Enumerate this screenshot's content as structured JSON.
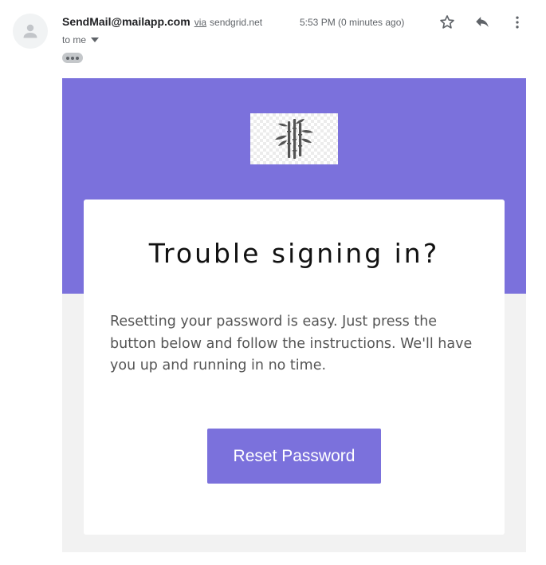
{
  "header": {
    "sender_name": "SendMail@mailapp.com",
    "via_label": "via",
    "via_domain": "sendgrid.net",
    "timestamp": "5:53 PM (0 minutes ago)",
    "to_label": "to me",
    "icons": {
      "avatar": "person-icon",
      "star": "star-icon",
      "reply": "reply-icon",
      "more": "more-vertical-icon",
      "to_dropdown": "caret-down-icon",
      "trimmed": "ellipsis-icon"
    }
  },
  "email": {
    "logo": "bamboo-logo",
    "title": "Trouble signing in?",
    "body_text": "Resetting your password is easy. Just press the button below and follow the instructions. We'll have you up and running in no time.",
    "button_label": "Reset Password",
    "colors": {
      "accent": "#7b71dc",
      "background": "#f2f2f2",
      "card": "#ffffff"
    }
  }
}
